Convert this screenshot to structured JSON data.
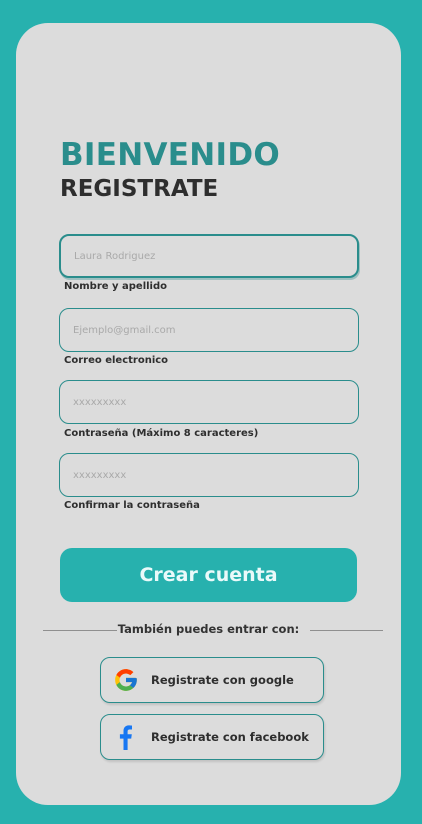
{
  "header": {
    "title": "BIENVENIDO",
    "subtitle": "REGISTRATE"
  },
  "form": {
    "fields": [
      {
        "placeholder": "Laura Rodriguez",
        "label": "Nombre y apellido"
      },
      {
        "placeholder": "Ejemplo@gmail.com",
        "label": "Correo electronico"
      },
      {
        "placeholder": "xxxxxxxxx",
        "label": "Contraseña  (Máximo 8 caracteres)"
      },
      {
        "placeholder": "xxxxxxxxx",
        "label": "Confirmar la contraseña"
      }
    ],
    "submit_label": "Crear cuenta"
  },
  "divider": {
    "text": "También puedes entrar con:"
  },
  "social": {
    "google_label": "Registrate con google",
    "facebook_label": "Registrate con facebook"
  },
  "colors": {
    "background": "#27b1ae",
    "card": "#dcdcdc",
    "accent": "#2a8d8c",
    "button": "#27b1ae",
    "facebook": "#1877f2"
  },
  "icons": {
    "google": "google-icon",
    "facebook": "facebook-icon"
  }
}
